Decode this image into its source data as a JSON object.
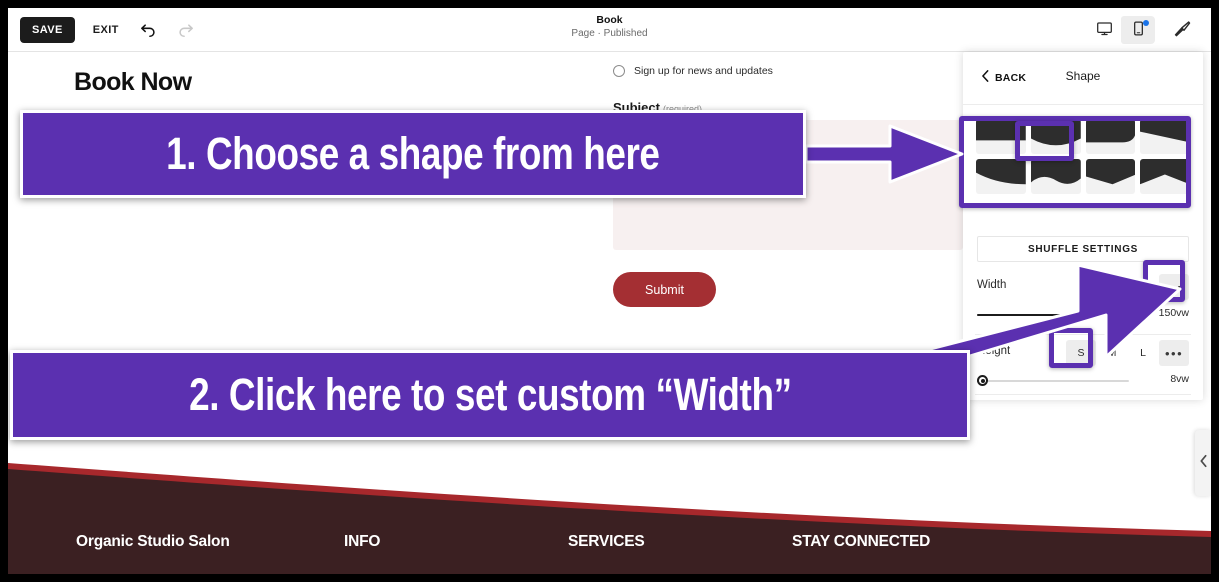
{
  "toolbar": {
    "save_label": "SAVE",
    "exit_label": "EXIT",
    "undo_icon": "undo-arrow-icon",
    "redo_icon": "redo-arrow-icon",
    "page_name": "Book",
    "page_status": "Page · Published",
    "desktop_view_icon": "desktop-monitor-icon",
    "mobile_view_icon": "mobile-phone-icon",
    "theme_icon": "paintbrush-icon"
  },
  "canvas": {
    "page_heading": "Book Now",
    "form": {
      "checkbox_label": "Sign up for news and updates",
      "subject_label": "Subject",
      "subject_required": "(required)",
      "submit_label": "Submit"
    },
    "footer": {
      "brand": "Organic Studio Salon",
      "col_info": "INFO",
      "col_services": "SERVICES",
      "col_stay_connected": "STAY CONNECTED",
      "bg_color": "#3b2022",
      "accent_color": "#a7282c"
    }
  },
  "panel": {
    "back_label": "BACK",
    "title": "Shape",
    "shapes": [
      {
        "name": "shape-flat",
        "selected": false
      },
      {
        "name": "shape-curve-down",
        "selected": true
      },
      {
        "name": "shape-round-corner",
        "selected": false
      },
      {
        "name": "shape-slant",
        "selected": false
      },
      {
        "name": "shape-concave",
        "selected": false
      },
      {
        "name": "shape-wave",
        "selected": false
      },
      {
        "name": "shape-angle-point",
        "selected": false
      },
      {
        "name": "shape-chevron",
        "selected": false
      }
    ],
    "shuffle_label": "SHUFFLE SETTINGS",
    "width": {
      "label": "Width",
      "more_icon": "ellipsis-icon",
      "value": "150vw",
      "slider_percent": 100
    },
    "height": {
      "label": "Height",
      "sizes": [
        "S",
        "M",
        "L"
      ],
      "selected_size": "S",
      "more_icon": "ellipsis-icon",
      "value": "8vw",
      "slider_percent": 4
    },
    "collapse_icon": "chevron-left-icon"
  },
  "annotations": {
    "accent_color": "#5b30b0",
    "step1": "1. Choose a shape from here",
    "step2": "2. Click here to set custom “Width”",
    "arrow1": "arrow-right-to-shape-grid",
    "arrow2": "arrow-up-right-to-width-ellipsis"
  }
}
